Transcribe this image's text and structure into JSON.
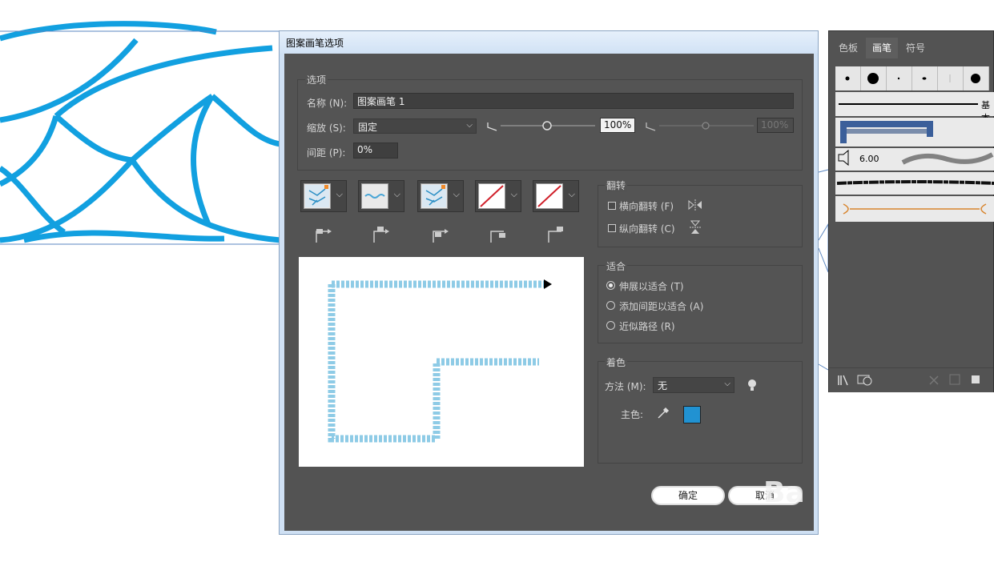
{
  "colors": {
    "artwork": "#12a0e0",
    "dialog_bg": "#535353",
    "swatch": "#2192d2"
  },
  "dialog": {
    "title": "图案画笔选项",
    "options_group": {
      "title": "选项",
      "name_label": "名称 (N):",
      "name_value": "图案画笔 1",
      "scale_label": "缩放 (S):",
      "scale_value": "固定",
      "scale_percent": "100%",
      "scale_percent_disabled": "100%",
      "spacing_label": "间距 (P):",
      "spacing_value": "0%"
    },
    "tiles": [
      {
        "name": "side-tile",
        "icon": "pattern-swatch-icon"
      },
      {
        "name": "outer-corner-tile",
        "icon": "braid-swatch-icon"
      },
      {
        "name": "inner-corner-tile",
        "icon": "pattern-swatch-icon"
      },
      {
        "name": "start-tile",
        "icon": "none-swatch-icon"
      },
      {
        "name": "end-tile",
        "icon": "none-swatch-icon"
      }
    ],
    "flip_group": {
      "title": "翻转",
      "horizontal": "横向翻转 (F)",
      "vertical": "纵向翻转 (C)"
    },
    "fit_group": {
      "title": "适合",
      "options": [
        "伸展以适合 (T)",
        "添加间距以适合 (A)",
        "近似路径 (R)"
      ],
      "selected": 0
    },
    "colorization_group": {
      "title": "着色",
      "method_label": "方法 (M):",
      "method_value": "无",
      "key_color_label": "主色:"
    },
    "ok_label": "确定",
    "cancel_label": "取消",
    "watermark": "Ba"
  },
  "brushes_panel": {
    "tabs": [
      "色板",
      "画笔",
      "符号"
    ],
    "active_tab": 1,
    "basic_label": "基本",
    "size_label": "6.00"
  }
}
